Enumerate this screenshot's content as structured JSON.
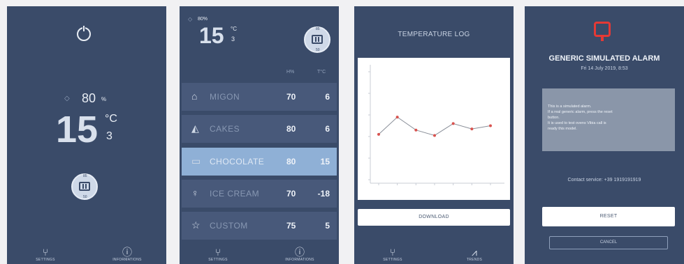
{
  "screen1": {
    "humidity_value": "80",
    "humidity_unit": "%",
    "temperature_main": "15",
    "temperature_unit": "°C",
    "temperature_sub": "3",
    "fan_top_label": "85",
    "fan_bottom_label": "50",
    "nav": [
      {
        "icon": "fork-knife-icon",
        "label": "SETTINGS"
      },
      {
        "icon": "info-icon",
        "label": "INFORMATIONS"
      }
    ]
  },
  "screen2": {
    "humidity_label": "80%",
    "temperature_main": "15",
    "temperature_unit": "°C",
    "temperature_sub": "3",
    "col_humidity_header": "H%",
    "col_temp_header": "T°C",
    "fan_top_label": "85",
    "fan_bottom_label": "50",
    "rows": [
      {
        "icon": "cupcake-icon",
        "name": "MIGON",
        "humidity": "70",
        "temp": "6",
        "selected": false
      },
      {
        "icon": "cake-icon",
        "name": "CAKES",
        "humidity": "80",
        "temp": "6",
        "selected": false
      },
      {
        "icon": "chocolate-icon",
        "name": "CHOCOLATE",
        "humidity": "80",
        "temp": "15",
        "selected": true
      },
      {
        "icon": "ice-cream-icon",
        "name": "ICE CREAM",
        "humidity": "70",
        "temp": "-18",
        "selected": false
      },
      {
        "icon": "star-icon",
        "name": "CUSTOM",
        "humidity": "75",
        "temp": "5",
        "selected": false
      }
    ],
    "nav": [
      {
        "icon": "fork-knife-icon",
        "label": "SETTINGS"
      },
      {
        "icon": "info-icon",
        "label": "INFORMATIONS"
      }
    ]
  },
  "screen3": {
    "title": "TEMPERATURE LOG",
    "download_label": "DOWNLOAD",
    "nav": [
      {
        "icon": "fork-knife-icon",
        "label": "SETTINGS"
      },
      {
        "icon": "chart-icon",
        "label": "TRENDS"
      }
    ],
    "chart_data": {
      "type": "line",
      "title": "",
      "xlabel": "",
      "ylabel": "",
      "x": [
        1,
        2,
        3,
        4,
        5,
        6,
        7
      ],
      "values": [
        4.2,
        5.8,
        4.6,
        4.1,
        5.2,
        4.7,
        5.0
      ],
      "ylim": [
        0,
        10
      ],
      "series_color": "#d9534f",
      "grid": false
    }
  },
  "screen4": {
    "alarm_title": "GENERIC SIMULATED ALARM",
    "alarm_date": "Fri 14 July 2019, 8:53",
    "message_line1": "This is a simulated alarm.",
    "message_line2": "If a real generic alarm, press the reset",
    "message_line3": "button.",
    "message_line4": "It is used to test ovens Vibia call is",
    "message_line5": "ready this model.",
    "contact_text": "Contact service: +39 1919191919",
    "reset_label": "RESET",
    "cancel_label": "CANCEL"
  },
  "colors": {
    "screen_bg": "#3a4b69",
    "row_bg": "#48597a",
    "row_selected": "#8fb0d6",
    "alarm_red": "#e53935"
  }
}
